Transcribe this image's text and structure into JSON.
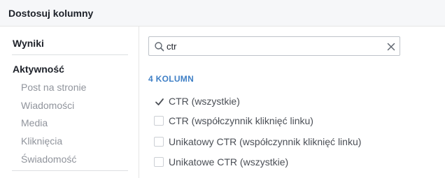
{
  "header": {
    "title": "Dostosuj kolumny"
  },
  "sidebar": {
    "section_results": "Wyniki",
    "section_activity": "Aktywność",
    "items": [
      {
        "label": "Post na stronie"
      },
      {
        "label": "Wiadomości"
      },
      {
        "label": "Media"
      },
      {
        "label": "Kliknięcia"
      },
      {
        "label": "Świadomość"
      }
    ]
  },
  "search": {
    "value": "ctr",
    "icon": "search-icon",
    "clear_icon": "close-icon"
  },
  "results": {
    "count_label": "4 KOLUMN",
    "options": [
      {
        "label": "CTR (wszystkie)",
        "checked": true
      },
      {
        "label": "CTR (współczynnik kliknięć linku)",
        "checked": false
      },
      {
        "label": "Unikatowy CTR (współczynnik kliknięć linku)",
        "checked": false
      },
      {
        "label": "Unikatowe CTR (wszystkie)",
        "checked": false
      }
    ]
  },
  "colors": {
    "accent": "#4080c6",
    "muted_text": "#90949c",
    "header_bg": "#f6f7f9"
  }
}
